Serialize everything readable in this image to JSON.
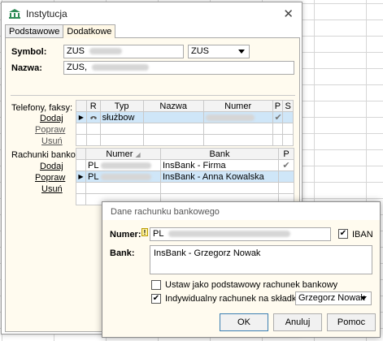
{
  "window": {
    "title": "Instytucja",
    "close_symbol": "✕",
    "tabs": [
      {
        "label": "Podstawowe",
        "active": false
      },
      {
        "label": "Dodatkowe",
        "active": true
      }
    ]
  },
  "form": {
    "symbol_label": "Symbol:",
    "symbol_value": "ZUS",
    "symbol_combo": "ZUS",
    "name_label": "Nazwa:",
    "name_value": "ZUS,"
  },
  "phones": {
    "section_label": "Telefony, faksy:",
    "links": [
      "Dodaj",
      "Popraw",
      "Usuń"
    ],
    "columns": [
      "R",
      "Typ",
      "Nazwa",
      "Numer",
      "P",
      "S"
    ],
    "rows": [
      {
        "typ": "służbow",
        "nazwa": "",
        "numer": "",
        "p": "✔",
        "s": ""
      }
    ]
  },
  "banks": {
    "section_label": "Rachunki bankowe:",
    "links": [
      "Dodaj",
      "Popraw",
      "Usuń"
    ],
    "columns": [
      "Numer",
      "Bank",
      "P"
    ],
    "rows": [
      {
        "numer": "PL",
        "bank": "InsBank - Firma",
        "p": "✔"
      },
      {
        "numer": "PL",
        "bank": "InsBank - Anna Kowalska",
        "p": ""
      }
    ]
  },
  "dialog": {
    "title": "Dane rachunku bankowego",
    "numer_label": "Numer:",
    "numer_value": "PL",
    "iban_label": "IBAN",
    "iban_checked": true,
    "bank_label": "Bank:",
    "bank_value": "InsBank - Grzegorz Nowak",
    "default_label": "Ustaw jako podstawowy rachunek bankowy",
    "default_checked": false,
    "individual_label": "Indywidualny rachunek na składki ZUS dla:",
    "individual_checked": true,
    "person_select": "Grzegorz Nowak",
    "buttons": {
      "ok": "OK",
      "cancel": "Anuluj",
      "help": "Pomoc"
    }
  }
}
